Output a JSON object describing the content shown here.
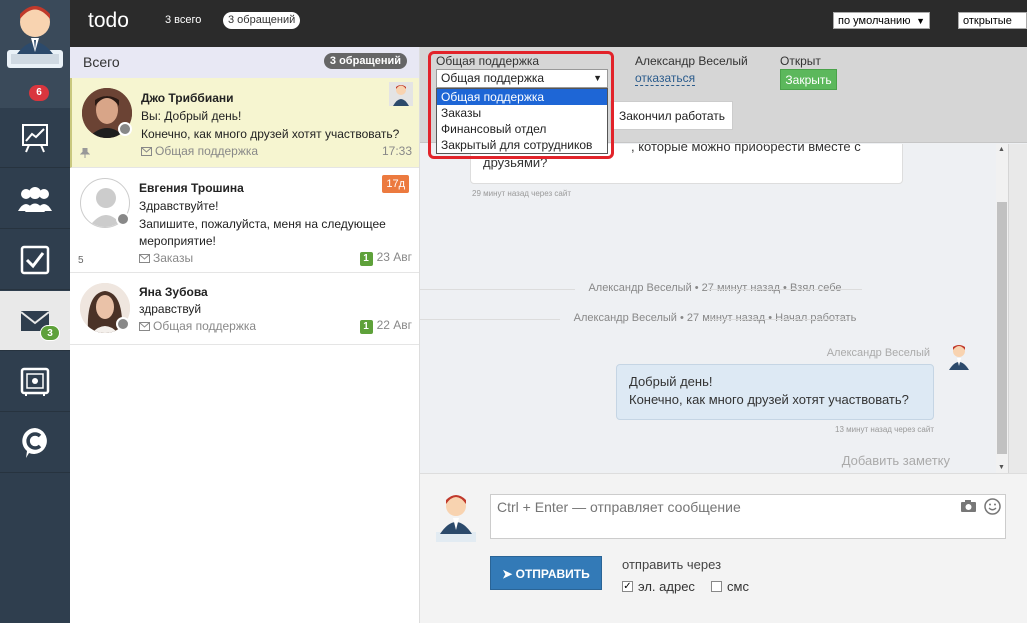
{
  "app": {
    "title": "todo",
    "total_label": "3 всего",
    "requests_label": "3 обращений",
    "sort_select": "по умолчанию",
    "status_select": "открытые"
  },
  "rail": {
    "notifications_count": "6",
    "messages_count": "3",
    "icons": [
      "agent-avatar",
      "chart-icon",
      "team-icon",
      "task-icon",
      "mail-icon",
      "safe-icon",
      "chat-logo-icon"
    ]
  },
  "list": {
    "title": "Всего",
    "count_label": "3 обращений",
    "conversations": [
      {
        "name": "Джо Триббиани",
        "line1": "Вы: Добрый день!",
        "line2": "Конечно, как много друзей хотят участвовать?",
        "department": "Общая поддержка",
        "time": "17:33"
      },
      {
        "name": "Евгения Трошина",
        "line1": "Здравствуйте!",
        "line2": "Запишите, пожалуйста, меня на следующее",
        "line3": "мероприятие!",
        "department": "Заказы",
        "unread": "1",
        "time": "23 Авг",
        "overdue": "17д",
        "left_count": "5"
      },
      {
        "name": "Яна Зубова",
        "line1": "здравствуй",
        "department": "Общая поддержка",
        "unread": "1",
        "time": "22 Авг"
      }
    ]
  },
  "props": {
    "department_label": "Общая поддержка",
    "department_value": "Общая поддержка",
    "department_options": [
      "Общая поддержка",
      "Заказы",
      "Финансовый отдел",
      "Закрытый для сотрудников"
    ],
    "assignee_label": "Александр Веселый",
    "assignee_action": "отказаться",
    "status_label": "Открыт",
    "close_button": "Закрыть",
    "finish_button": "Закончил работать"
  },
  "messages": {
    "incoming_text": ", которые можно приобрести вместе с друзьями?",
    "incoming_meta": "29 минут назад через сайт",
    "system1": "Александр Веселый • 27 минут назад • Взял себе",
    "system2": "Александр Веселый • 27 минут назад • Начал работать",
    "agent_name": "Александр Веселый",
    "outgoing_line1": "Добрый день!",
    "outgoing_line2": "Конечно, как много друзей хотят участвовать?",
    "outgoing_meta": "13 минут назад через сайт",
    "add_note": "Добавить заметку"
  },
  "composer": {
    "placeholder": "Ctrl + Enter — отправляет сообщение",
    "send_button": "ОТПРАВИТЬ",
    "send_via_label": "отправить через",
    "email_label": "эл. адрес",
    "sms_label": "смс"
  },
  "colors": {
    "rail_bg": "#2f3e4e",
    "topbar_bg": "#2b2b2b",
    "selected_conv": "#f6f5d0",
    "highlight": "#e2232a",
    "send_button": "#337ab7",
    "close_button": "#5cb85c"
  }
}
